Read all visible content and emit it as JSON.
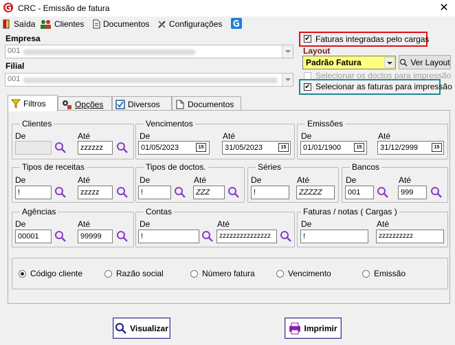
{
  "window": {
    "title": "CRC - Emissão de fatura",
    "close_glyph": "✕"
  },
  "menu": {
    "saida": "Saída",
    "clientes": "Clientes",
    "documentos": "Documentos",
    "configuracoes": "Configurações"
  },
  "header": {
    "empresa_label": "Empresa",
    "empresa_value": "001",
    "filial_label": "Filial",
    "filial_value": "001",
    "check_faturas_integradas": "Faturas integradas pelo cargas",
    "layout_label": "Layout",
    "layout_value": "Padrão Fatura",
    "ver_layout": "Ver Layout",
    "check_selecionar_doctos": "Selecionar os doctos para impressão",
    "check_selecionar_faturas": "Selecionar as faturas para impressão"
  },
  "tabs": [
    "Filtros",
    "Opções",
    "Diversos",
    "Documentos"
  ],
  "filters": {
    "de": "De",
    "ate": "Até",
    "clientes": {
      "title": "Clientes",
      "de": "",
      "ate": "zzzzzz"
    },
    "vencimentos": {
      "title": "Vencimentos",
      "de": "01/05/2023",
      "ate": "31/05/2023"
    },
    "emissoes": {
      "title": "Emissões",
      "de": "01/01/1900",
      "ate": "31/12/2999"
    },
    "tipos_receitas": {
      "title": "Tipos de receitas",
      "de": "!",
      "ate": "zzzzz"
    },
    "tipos_doctos": {
      "title": "Tipos de doctos.",
      "de": "!",
      "ate": "ZZZ"
    },
    "series": {
      "title": "Séries",
      "de": "!",
      "ate": "ZZZZZ"
    },
    "bancos": {
      "title": "Bancos",
      "de": "001",
      "ate": "999"
    },
    "agencias": {
      "title": "Agências",
      "de": "00001",
      "ate": "99999"
    },
    "contas": {
      "title": "Contas",
      "de": "!",
      "ate": "zzzzzzzzzzzzzzz"
    },
    "faturas_notas": {
      "title": "Faturas / notas ( Cargas )",
      "de": "!",
      "ate": "zzzzzzzzzz"
    },
    "cal_glyph": "15"
  },
  "order": {
    "options": [
      "Código cliente",
      "Razão social",
      "Número fatura",
      "Vencimento",
      "Emissão"
    ],
    "selected": "Código cliente"
  },
  "buttons": {
    "visualizar": "Visualizar",
    "imprimir": "Imprimir"
  },
  "colors": {
    "layout_bg": "#ffff80",
    "red_highlight": "#e0101a",
    "teal_highlight": "#1a8a8e",
    "magnifier": "#8a3cc8"
  }
}
